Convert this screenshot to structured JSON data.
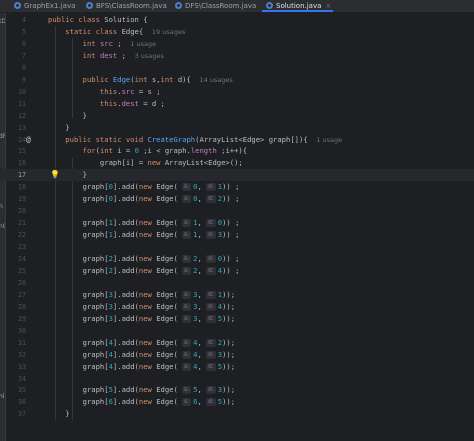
{
  "tabs": [
    {
      "label": "GraphEx1.java",
      "active": false
    },
    {
      "label": "BFS\\ClassRoom.java",
      "active": false
    },
    {
      "label": "DFS\\ClassRoom.java",
      "active": false
    },
    {
      "label": "Solution.java",
      "active": true
    }
  ],
  "tab_close": "×",
  "left_panel_fragments": [
    "tDe",
    "dRA",
    "n",
    "nCol",
    "nl"
  ],
  "gutter_icons": {
    "override": "@",
    "bulb": "💡"
  },
  "lines": [
    {
      "n": "4",
      "segs": [
        {
          "t": "public class ",
          "c": "kw"
        },
        {
          "t": "Solution {",
          "c": "tp"
        }
      ]
    },
    {
      "n": "5",
      "segs": [
        {
          "t": "    static class ",
          "c": "kw"
        },
        {
          "t": "Edge{  ",
          "c": "tp"
        },
        {
          "t": "19 usages",
          "c": "hint"
        }
      ]
    },
    {
      "n": "6",
      "segs": [
        {
          "t": "        int ",
          "c": "kw"
        },
        {
          "t": "src",
          "c": "fld"
        },
        {
          "t": " ;  ",
          "c": "tp"
        },
        {
          "t": "1 usage",
          "c": "hint"
        }
      ]
    },
    {
      "n": "7",
      "segs": [
        {
          "t": "        int ",
          "c": "kw"
        },
        {
          "t": "dest",
          "c": "fld"
        },
        {
          "t": " ;  ",
          "c": "tp"
        },
        {
          "t": "3 usages",
          "c": "hint"
        }
      ]
    },
    {
      "n": "8",
      "segs": []
    },
    {
      "n": "9",
      "segs": [
        {
          "t": "        public ",
          "c": "kw"
        },
        {
          "t": "Edge",
          "c": "fn"
        },
        {
          "t": "(",
          "c": "tp"
        },
        {
          "t": "int ",
          "c": "kw"
        },
        {
          "t": "s,",
          "c": "tp"
        },
        {
          "t": "int ",
          "c": "kw"
        },
        {
          "t": "d){  ",
          "c": "tp"
        },
        {
          "t": "14 usages",
          "c": "hint"
        }
      ]
    },
    {
      "n": "10",
      "segs": [
        {
          "t": "            this",
          "c": "kw"
        },
        {
          "t": ".",
          "c": "tp"
        },
        {
          "t": "src",
          "c": "fld"
        },
        {
          "t": " = s ;",
          "c": "tp"
        }
      ]
    },
    {
      "n": "11",
      "segs": [
        {
          "t": "            this",
          "c": "kw"
        },
        {
          "t": ".",
          "c": "tp"
        },
        {
          "t": "dest",
          "c": "fld"
        },
        {
          "t": " = d ;",
          "c": "tp"
        }
      ]
    },
    {
      "n": "12",
      "segs": [
        {
          "t": "        }",
          "c": "tp"
        }
      ]
    },
    {
      "n": "13",
      "segs": [
        {
          "t": "    }",
          "c": "tp"
        }
      ]
    },
    {
      "n": "14",
      "segs": [
        {
          "t": "    public static void ",
          "c": "kw"
        },
        {
          "t": "CreateGraph",
          "c": "fn"
        },
        {
          "t": "(ArrayList<Edge> graph[]){  ",
          "c": "tp"
        },
        {
          "t": "1 usage",
          "c": "hint"
        }
      ]
    },
    {
      "n": "15",
      "segs": [
        {
          "t": "        for",
          "c": "kw"
        },
        {
          "t": "(",
          "c": "tp"
        },
        {
          "t": "int ",
          "c": "kw"
        },
        {
          "t": "i = ",
          "c": "tp"
        },
        {
          "t": "0",
          "c": "num"
        },
        {
          "t": " ;i < graph.",
          "c": "tp"
        },
        {
          "t": "length",
          "c": "fld"
        },
        {
          "t": " ;i++){",
          "c": "tp"
        }
      ]
    },
    {
      "n": "16",
      "segs": [
        {
          "t": "            graph[i] = ",
          "c": "tp"
        },
        {
          "t": "new ",
          "c": "kw"
        },
        {
          "t": "ArrayList<Edge>();",
          "c": "tp"
        }
      ]
    },
    {
      "n": "17",
      "segs": [
        {
          "t": "        }",
          "c": "tp"
        }
      ]
    },
    {
      "n": "18",
      "segs": [
        {
          "t": "        graph[",
          "c": "tp"
        },
        {
          "t": "0",
          "c": "num"
        },
        {
          "t": "].add(",
          "c": "tp"
        },
        {
          "t": "new ",
          "c": "kw"
        },
        {
          "t": "Edge( ",
          "c": "tp"
        },
        {
          "t": "s:",
          "c": "inlay"
        },
        {
          "t": "0",
          "c": "num"
        },
        {
          "t": ", ",
          "c": "tp"
        },
        {
          "t": "d:",
          "c": "inlay"
        },
        {
          "t": "1",
          "c": "num"
        },
        {
          "t": ")) ;",
          "c": "tp"
        }
      ]
    },
    {
      "n": "19",
      "segs": [
        {
          "t": "        graph[",
          "c": "tp"
        },
        {
          "t": "0",
          "c": "num"
        },
        {
          "t": "].add(",
          "c": "tp"
        },
        {
          "t": "new ",
          "c": "kw"
        },
        {
          "t": "Edge( ",
          "c": "tp"
        },
        {
          "t": "s:",
          "c": "inlay"
        },
        {
          "t": "0",
          "c": "num"
        },
        {
          "t": ", ",
          "c": "tp"
        },
        {
          "t": "d:",
          "c": "inlay"
        },
        {
          "t": "2",
          "c": "num"
        },
        {
          "t": ")) ;",
          "c": "tp"
        }
      ]
    },
    {
      "n": "20",
      "segs": []
    },
    {
      "n": "21",
      "segs": [
        {
          "t": "        graph[",
          "c": "tp"
        },
        {
          "t": "1",
          "c": "num"
        },
        {
          "t": "].add(",
          "c": "tp"
        },
        {
          "t": "new ",
          "c": "kw"
        },
        {
          "t": "Edge( ",
          "c": "tp"
        },
        {
          "t": "s:",
          "c": "inlay"
        },
        {
          "t": "1",
          "c": "num"
        },
        {
          "t": ", ",
          "c": "tp"
        },
        {
          "t": "d:",
          "c": "inlay"
        },
        {
          "t": "0",
          "c": "num"
        },
        {
          "t": ")) ;",
          "c": "tp"
        }
      ]
    },
    {
      "n": "22",
      "segs": [
        {
          "t": "        graph[",
          "c": "tp"
        },
        {
          "t": "1",
          "c": "num"
        },
        {
          "t": "].add(",
          "c": "tp"
        },
        {
          "t": "new ",
          "c": "kw"
        },
        {
          "t": "Edge( ",
          "c": "tp"
        },
        {
          "t": "s:",
          "c": "inlay"
        },
        {
          "t": "1",
          "c": "num"
        },
        {
          "t": ", ",
          "c": "tp"
        },
        {
          "t": "d:",
          "c": "inlay"
        },
        {
          "t": "3",
          "c": "num"
        },
        {
          "t": ")) ;",
          "c": "tp"
        }
      ]
    },
    {
      "n": "23",
      "segs": []
    },
    {
      "n": "24",
      "segs": [
        {
          "t": "        graph[",
          "c": "tp"
        },
        {
          "t": "2",
          "c": "num"
        },
        {
          "t": "].add(",
          "c": "tp"
        },
        {
          "t": "new ",
          "c": "kw"
        },
        {
          "t": "Edge( ",
          "c": "tp"
        },
        {
          "t": "s:",
          "c": "inlay"
        },
        {
          "t": "2",
          "c": "num"
        },
        {
          "t": ", ",
          "c": "tp"
        },
        {
          "t": "d:",
          "c": "inlay"
        },
        {
          "t": "0",
          "c": "num"
        },
        {
          "t": ")) ;",
          "c": "tp"
        }
      ]
    },
    {
      "n": "25",
      "segs": [
        {
          "t": "        graph[",
          "c": "tp"
        },
        {
          "t": "2",
          "c": "num"
        },
        {
          "t": "].add(",
          "c": "tp"
        },
        {
          "t": "new ",
          "c": "kw"
        },
        {
          "t": "Edge( ",
          "c": "tp"
        },
        {
          "t": "s:",
          "c": "inlay"
        },
        {
          "t": "2",
          "c": "num"
        },
        {
          "t": ", ",
          "c": "tp"
        },
        {
          "t": "d:",
          "c": "inlay"
        },
        {
          "t": "4",
          "c": "num"
        },
        {
          "t": ")) ;",
          "c": "tp"
        }
      ]
    },
    {
      "n": "26",
      "segs": []
    },
    {
      "n": "27",
      "segs": [
        {
          "t": "        graph[",
          "c": "tp"
        },
        {
          "t": "3",
          "c": "num"
        },
        {
          "t": "].add(",
          "c": "tp"
        },
        {
          "t": "new ",
          "c": "kw"
        },
        {
          "t": "Edge( ",
          "c": "tp"
        },
        {
          "t": "s:",
          "c": "inlay"
        },
        {
          "t": "3",
          "c": "num"
        },
        {
          "t": ", ",
          "c": "tp"
        },
        {
          "t": "d:",
          "c": "inlay"
        },
        {
          "t": "1",
          "c": "num"
        },
        {
          "t": "));",
          "c": "tp"
        }
      ]
    },
    {
      "n": "28",
      "segs": [
        {
          "t": "        graph[",
          "c": "tp"
        },
        {
          "t": "3",
          "c": "num"
        },
        {
          "t": "].add(",
          "c": "tp"
        },
        {
          "t": "new ",
          "c": "kw"
        },
        {
          "t": "Edge( ",
          "c": "tp"
        },
        {
          "t": "s:",
          "c": "inlay"
        },
        {
          "t": "3",
          "c": "num"
        },
        {
          "t": ", ",
          "c": "tp"
        },
        {
          "t": "d:",
          "c": "inlay"
        },
        {
          "t": "4",
          "c": "num"
        },
        {
          "t": "));",
          "c": "tp"
        }
      ]
    },
    {
      "n": "29",
      "segs": [
        {
          "t": "        graph[",
          "c": "tp"
        },
        {
          "t": "3",
          "c": "num"
        },
        {
          "t": "].add(",
          "c": "tp"
        },
        {
          "t": "new ",
          "c": "kw"
        },
        {
          "t": "Edge( ",
          "c": "tp"
        },
        {
          "t": "s:",
          "c": "inlay"
        },
        {
          "t": "3",
          "c": "num"
        },
        {
          "t": ", ",
          "c": "tp"
        },
        {
          "t": "d:",
          "c": "inlay"
        },
        {
          "t": "5",
          "c": "num"
        },
        {
          "t": "));",
          "c": "tp"
        }
      ]
    },
    {
      "n": "30",
      "segs": []
    },
    {
      "n": "31",
      "segs": [
        {
          "t": "        graph[",
          "c": "tp"
        },
        {
          "t": "4",
          "c": "num"
        },
        {
          "t": "].add(",
          "c": "tp"
        },
        {
          "t": "new ",
          "c": "kw"
        },
        {
          "t": "Edge( ",
          "c": "tp"
        },
        {
          "t": "s:",
          "c": "inlay"
        },
        {
          "t": "4",
          "c": "num"
        },
        {
          "t": ", ",
          "c": "tp"
        },
        {
          "t": "d:",
          "c": "inlay"
        },
        {
          "t": "2",
          "c": "num"
        },
        {
          "t": "));",
          "c": "tp"
        }
      ]
    },
    {
      "n": "32",
      "segs": [
        {
          "t": "        graph[",
          "c": "tp"
        },
        {
          "t": "4",
          "c": "num"
        },
        {
          "t": "].add(",
          "c": "tp"
        },
        {
          "t": "new ",
          "c": "kw"
        },
        {
          "t": "Edge( ",
          "c": "tp"
        },
        {
          "t": "s:",
          "c": "inlay"
        },
        {
          "t": "4",
          "c": "num"
        },
        {
          "t": ", ",
          "c": "tp"
        },
        {
          "t": "d:",
          "c": "inlay"
        },
        {
          "t": "3",
          "c": "num"
        },
        {
          "t": "));",
          "c": "tp"
        }
      ]
    },
    {
      "n": "33",
      "segs": [
        {
          "t": "        graph[",
          "c": "tp"
        },
        {
          "t": "4",
          "c": "num"
        },
        {
          "t": "].add(",
          "c": "tp"
        },
        {
          "t": "new ",
          "c": "kw"
        },
        {
          "t": "Edge( ",
          "c": "tp"
        },
        {
          "t": "s:",
          "c": "inlay"
        },
        {
          "t": "4",
          "c": "num"
        },
        {
          "t": ", ",
          "c": "tp"
        },
        {
          "t": "d:",
          "c": "inlay"
        },
        {
          "t": "5",
          "c": "num"
        },
        {
          "t": "));",
          "c": "tp"
        }
      ]
    },
    {
      "n": "34",
      "segs": []
    },
    {
      "n": "35",
      "segs": [
        {
          "t": "        graph[",
          "c": "tp"
        },
        {
          "t": "5",
          "c": "num"
        },
        {
          "t": "].add(",
          "c": "tp"
        },
        {
          "t": "new ",
          "c": "kw"
        },
        {
          "t": "Edge( ",
          "c": "tp"
        },
        {
          "t": "s:",
          "c": "inlay"
        },
        {
          "t": "5",
          "c": "num"
        },
        {
          "t": ", ",
          "c": "tp"
        },
        {
          "t": "d:",
          "c": "inlay"
        },
        {
          "t": "3",
          "c": "num"
        },
        {
          "t": "));",
          "c": "tp"
        }
      ]
    },
    {
      "n": "36",
      "segs": [
        {
          "t": "        graph[",
          "c": "tp"
        },
        {
          "t": "6",
          "c": "num"
        },
        {
          "t": "].add(",
          "c": "tp"
        },
        {
          "t": "new ",
          "c": "kw"
        },
        {
          "t": "Edge( ",
          "c": "tp"
        },
        {
          "t": "s:",
          "c": "inlay"
        },
        {
          "t": "6",
          "c": "num"
        },
        {
          "t": ", ",
          "c": "tp"
        },
        {
          "t": "d:",
          "c": "inlay"
        },
        {
          "t": "5",
          "c": "num"
        },
        {
          "t": "));",
          "c": "tp"
        }
      ]
    },
    {
      "n": "37",
      "segs": [
        {
          "t": "    }",
          "c": "tp"
        }
      ]
    }
  ],
  "current_line": "17",
  "colors": {
    "background": "#1e1f22",
    "keyword": "#cf8e6d",
    "function": "#56a8f5",
    "field": "#c77dbb",
    "number": "#2aacb8",
    "active_tab_underline": "#3574f0"
  }
}
